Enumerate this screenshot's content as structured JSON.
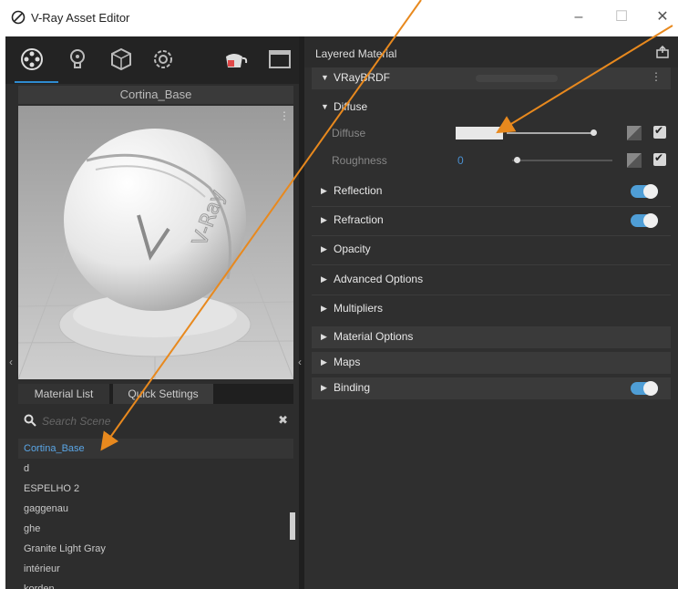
{
  "window": {
    "title": "V-Ray Asset Editor",
    "minimize": "–",
    "maximize": "☐",
    "close": "✕"
  },
  "left_panel": {
    "asset_name": "Cortina_Base",
    "tabs": [
      "Material List",
      "Quick Settings"
    ],
    "search_placeholder": "Search Scene",
    "materials": [
      "Cortina_Base",
      "d",
      "ESPELHO 2",
      "gaggenau",
      "ghe",
      "Granite Light Gray",
      "intérieur",
      "korden"
    ],
    "selected_index": 0
  },
  "right_panel": {
    "header_label": "Layered Material",
    "brdf_label": "VRayBRDF",
    "diffuse_section": "Diffuse",
    "params": {
      "diffuse_label": "Diffuse",
      "roughness_label": "Roughness",
      "roughness_value": "0"
    },
    "sections": [
      "Reflection",
      "Refraction",
      "Opacity",
      "Advanced Options",
      "Multipliers"
    ],
    "bottom_sections": [
      "Material Options",
      "Maps",
      "Binding"
    ]
  },
  "colors": {
    "accent": "#4f9ed6",
    "annotation_arrow": "#e8891e"
  }
}
